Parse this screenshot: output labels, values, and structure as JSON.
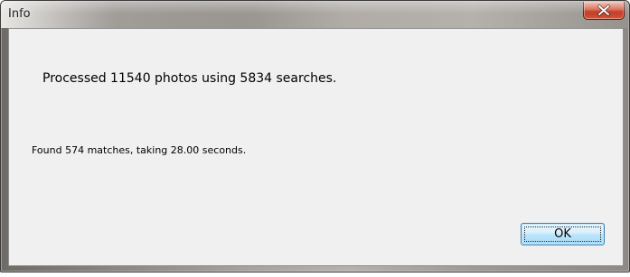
{
  "window": {
    "title": "Info",
    "close_icon": "close-x-icon"
  },
  "dialog": {
    "main_message": "Processed 11540 photos using 5834 searches.",
    "detail_message": "Found 574 matches, taking 28.00 seconds.",
    "ok_label": "OK"
  },
  "colors": {
    "close_button": "#c13a22",
    "client_background": "#f0f0f0",
    "ok_button_border": "#3c7fb1"
  }
}
